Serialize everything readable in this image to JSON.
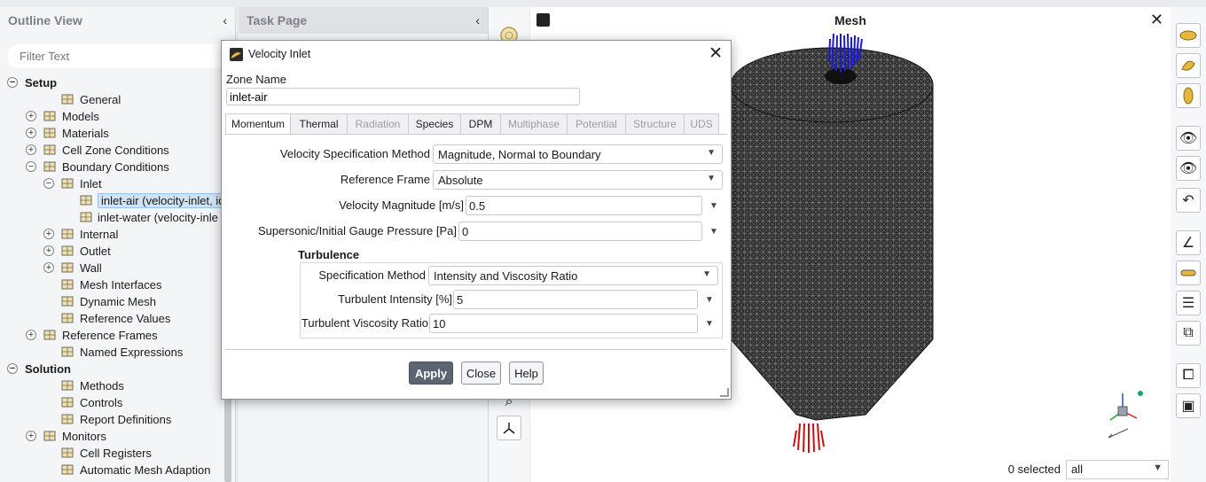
{
  "outline": {
    "title": "Outline View",
    "filter_placeholder": "Filter Text",
    "tree": [
      {
        "label": "Setup",
        "level": 0,
        "toggle": "−",
        "icon": "none",
        "bold": true
      },
      {
        "label": "General",
        "level": 2,
        "toggle": "",
        "icon": "general-icon"
      },
      {
        "label": "Models",
        "level": 1,
        "toggle": "+",
        "icon": "models-icon"
      },
      {
        "label": "Materials",
        "level": 1,
        "toggle": "+",
        "icon": "materials-icon"
      },
      {
        "label": "Cell Zone Conditions",
        "level": 1,
        "toggle": "+",
        "icon": "cell-zone-icon"
      },
      {
        "label": "Boundary Conditions",
        "level": 1,
        "toggle": "−",
        "icon": "boundary-icon"
      },
      {
        "label": "Inlet",
        "level": 2,
        "toggle": "−",
        "icon": "inlet-icon"
      },
      {
        "label": "inlet-air (velocity-inlet, id",
        "level": 3,
        "toggle": "",
        "icon": "inlet-icon",
        "selected": true
      },
      {
        "label": "inlet-water (velocity-inle",
        "level": 3,
        "toggle": "",
        "icon": "inlet-icon"
      },
      {
        "label": "Internal",
        "level": 2,
        "toggle": "+",
        "icon": "internal-icon"
      },
      {
        "label": "Outlet",
        "level": 2,
        "toggle": "+",
        "icon": "outlet-icon"
      },
      {
        "label": "Wall",
        "level": 2,
        "toggle": "+",
        "icon": "wall-icon"
      },
      {
        "label": "Mesh Interfaces",
        "level": 2,
        "toggle": "",
        "icon": "mesh-interfaces-icon"
      },
      {
        "label": "Dynamic Mesh",
        "level": 2,
        "toggle": "",
        "icon": "dynamic-mesh-icon"
      },
      {
        "label": "Reference Values",
        "level": 2,
        "toggle": "",
        "icon": "reference-values-icon"
      },
      {
        "label": "Reference Frames",
        "level": 1,
        "toggle": "+",
        "icon": "reference-frames-icon"
      },
      {
        "label": "Named Expressions",
        "level": 2,
        "toggle": "",
        "icon": "named-expressions-icon"
      },
      {
        "label": "Solution",
        "level": 0,
        "toggle": "−",
        "icon": "none",
        "bold": true
      },
      {
        "label": "Methods",
        "level": 2,
        "toggle": "",
        "icon": "methods-icon"
      },
      {
        "label": "Controls",
        "level": 2,
        "toggle": "",
        "icon": "controls-icon"
      },
      {
        "label": "Report Definitions",
        "level": 2,
        "toggle": "",
        "icon": "report-definitions-icon"
      },
      {
        "label": "Monitors",
        "level": 1,
        "toggle": "+",
        "icon": "monitors-icon"
      },
      {
        "label": "Cell Registers",
        "level": 2,
        "toggle": "",
        "icon": "cell-registers-icon"
      },
      {
        "label": "Automatic Mesh Adaption",
        "level": 2,
        "toggle": "",
        "icon": "mesh-adaption-icon"
      }
    ]
  },
  "task_page": {
    "title": "Task Page"
  },
  "graphics": {
    "title": "Mesh",
    "selected_count": "0 selected",
    "selection_filter": "all"
  },
  "dialog": {
    "title": "Velocity Inlet",
    "zone_name_label": "Zone Name",
    "zone_name_value": "inlet-air",
    "tabs": [
      {
        "label": "Momentum",
        "active": true,
        "enabled": true
      },
      {
        "label": "Thermal",
        "active": false,
        "enabled": true
      },
      {
        "label": "Radiation",
        "active": false,
        "enabled": false
      },
      {
        "label": "Species",
        "active": false,
        "enabled": true
      },
      {
        "label": "DPM",
        "active": false,
        "enabled": true
      },
      {
        "label": "Multiphase",
        "active": false,
        "enabled": false
      },
      {
        "label": "Potential",
        "active": false,
        "enabled": false
      },
      {
        "label": "Structure",
        "active": false,
        "enabled": false
      },
      {
        "label": "UDS",
        "active": false,
        "enabled": false
      }
    ],
    "momentum": {
      "velocity_spec_label": "Velocity Specification Method",
      "velocity_spec_value": "Magnitude, Normal to Boundary",
      "reference_frame_label": "Reference Frame",
      "reference_frame_value": "Absolute",
      "velocity_magnitude_label": "Velocity Magnitude [m/s]",
      "velocity_magnitude_value": "0.5",
      "gauge_pressure_label": "Supersonic/Initial Gauge Pressure [Pa]",
      "gauge_pressure_value": "0"
    },
    "turbulence": {
      "title": "Turbulence",
      "spec_method_label": "Specification Method",
      "spec_method_value": "Intensity and Viscosity Ratio",
      "intensity_label": "Turbulent Intensity [%]",
      "intensity_value": "5",
      "viscosity_ratio_label": "Turbulent Viscosity Ratio",
      "viscosity_ratio_value": "10"
    },
    "buttons": {
      "apply": "Apply",
      "close": "Close",
      "help": "Help"
    }
  },
  "colors": {
    "inlet_vectors": "#1a1ad6",
    "outlet_vectors": "#cc1010",
    "mesh": "#2a2a2a",
    "mesh_lines": "#8a8a8a"
  }
}
